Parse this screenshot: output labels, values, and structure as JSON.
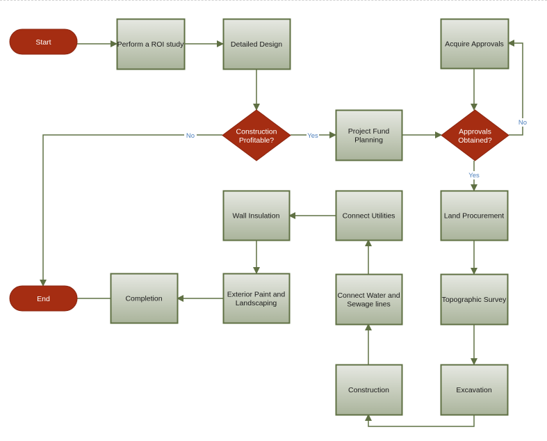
{
  "diagram": {
    "type": "flowchart",
    "colors": {
      "terminal_fill": "#a52d12",
      "decision_fill": "#a52d12",
      "process_fill_top": "#e6e8e2",
      "process_fill_bottom": "#aab49b",
      "process_border": "#5f7043",
      "connector": "#5f7043",
      "label_text": "#4f81bd"
    },
    "nodes": [
      {
        "id": "start",
        "shape": "terminal",
        "label": "Start"
      },
      {
        "id": "roi",
        "shape": "process",
        "label": "Perform a ROI study"
      },
      {
        "id": "design",
        "shape": "process",
        "label": "Detailed Design"
      },
      {
        "id": "profitable",
        "shape": "decision",
        "label": [
          "Construction",
          "Profitable?"
        ]
      },
      {
        "id": "fund",
        "shape": "process",
        "label": [
          "Project Fund",
          "Planning"
        ]
      },
      {
        "id": "approvals_obtained",
        "shape": "decision",
        "label": [
          "Approvals",
          "Obtained?"
        ]
      },
      {
        "id": "acquire",
        "shape": "process",
        "label": "Acquire Approvals"
      },
      {
        "id": "land",
        "shape": "process",
        "label": "Land Procurement"
      },
      {
        "id": "survey",
        "shape": "process",
        "label": "Topographic Survey"
      },
      {
        "id": "excavation",
        "shape": "process",
        "label": "Excavation"
      },
      {
        "id": "construction",
        "shape": "process",
        "label": "Construction"
      },
      {
        "id": "water",
        "shape": "process",
        "label": [
          "Connect Water and",
          "Sewage lines"
        ]
      },
      {
        "id": "utilities",
        "shape": "process",
        "label": "Connect Utilities"
      },
      {
        "id": "insulation",
        "shape": "process",
        "label": "Wall Insulation"
      },
      {
        "id": "paint",
        "shape": "process",
        "label": [
          "Exterior Paint and",
          "Landscaping"
        ]
      },
      {
        "id": "completion",
        "shape": "process",
        "label": "Completion"
      },
      {
        "id": "end",
        "shape": "terminal",
        "label": "End"
      }
    ],
    "edges": [
      {
        "from": "start",
        "to": "roi",
        "label": ""
      },
      {
        "from": "roi",
        "to": "design",
        "label": ""
      },
      {
        "from": "design",
        "to": "profitable",
        "label": ""
      },
      {
        "from": "profitable",
        "to": "fund",
        "label": "Yes"
      },
      {
        "from": "profitable",
        "to": "end",
        "label": "No"
      },
      {
        "from": "fund",
        "to": "approvals_obtained",
        "label": ""
      },
      {
        "from": "acquire",
        "to": "approvals_obtained",
        "label": ""
      },
      {
        "from": "approvals_obtained",
        "to": "acquire",
        "label": "No"
      },
      {
        "from": "approvals_obtained",
        "to": "land",
        "label": "Yes"
      },
      {
        "from": "land",
        "to": "survey",
        "label": ""
      },
      {
        "from": "survey",
        "to": "excavation",
        "label": ""
      },
      {
        "from": "excavation",
        "to": "construction",
        "label": ""
      },
      {
        "from": "construction",
        "to": "water",
        "label": ""
      },
      {
        "from": "water",
        "to": "utilities",
        "label": ""
      },
      {
        "from": "utilities",
        "to": "insulation",
        "label": ""
      },
      {
        "from": "insulation",
        "to": "paint",
        "label": ""
      },
      {
        "from": "paint",
        "to": "completion",
        "label": ""
      },
      {
        "from": "completion",
        "to": "end",
        "label": ""
      }
    ]
  }
}
